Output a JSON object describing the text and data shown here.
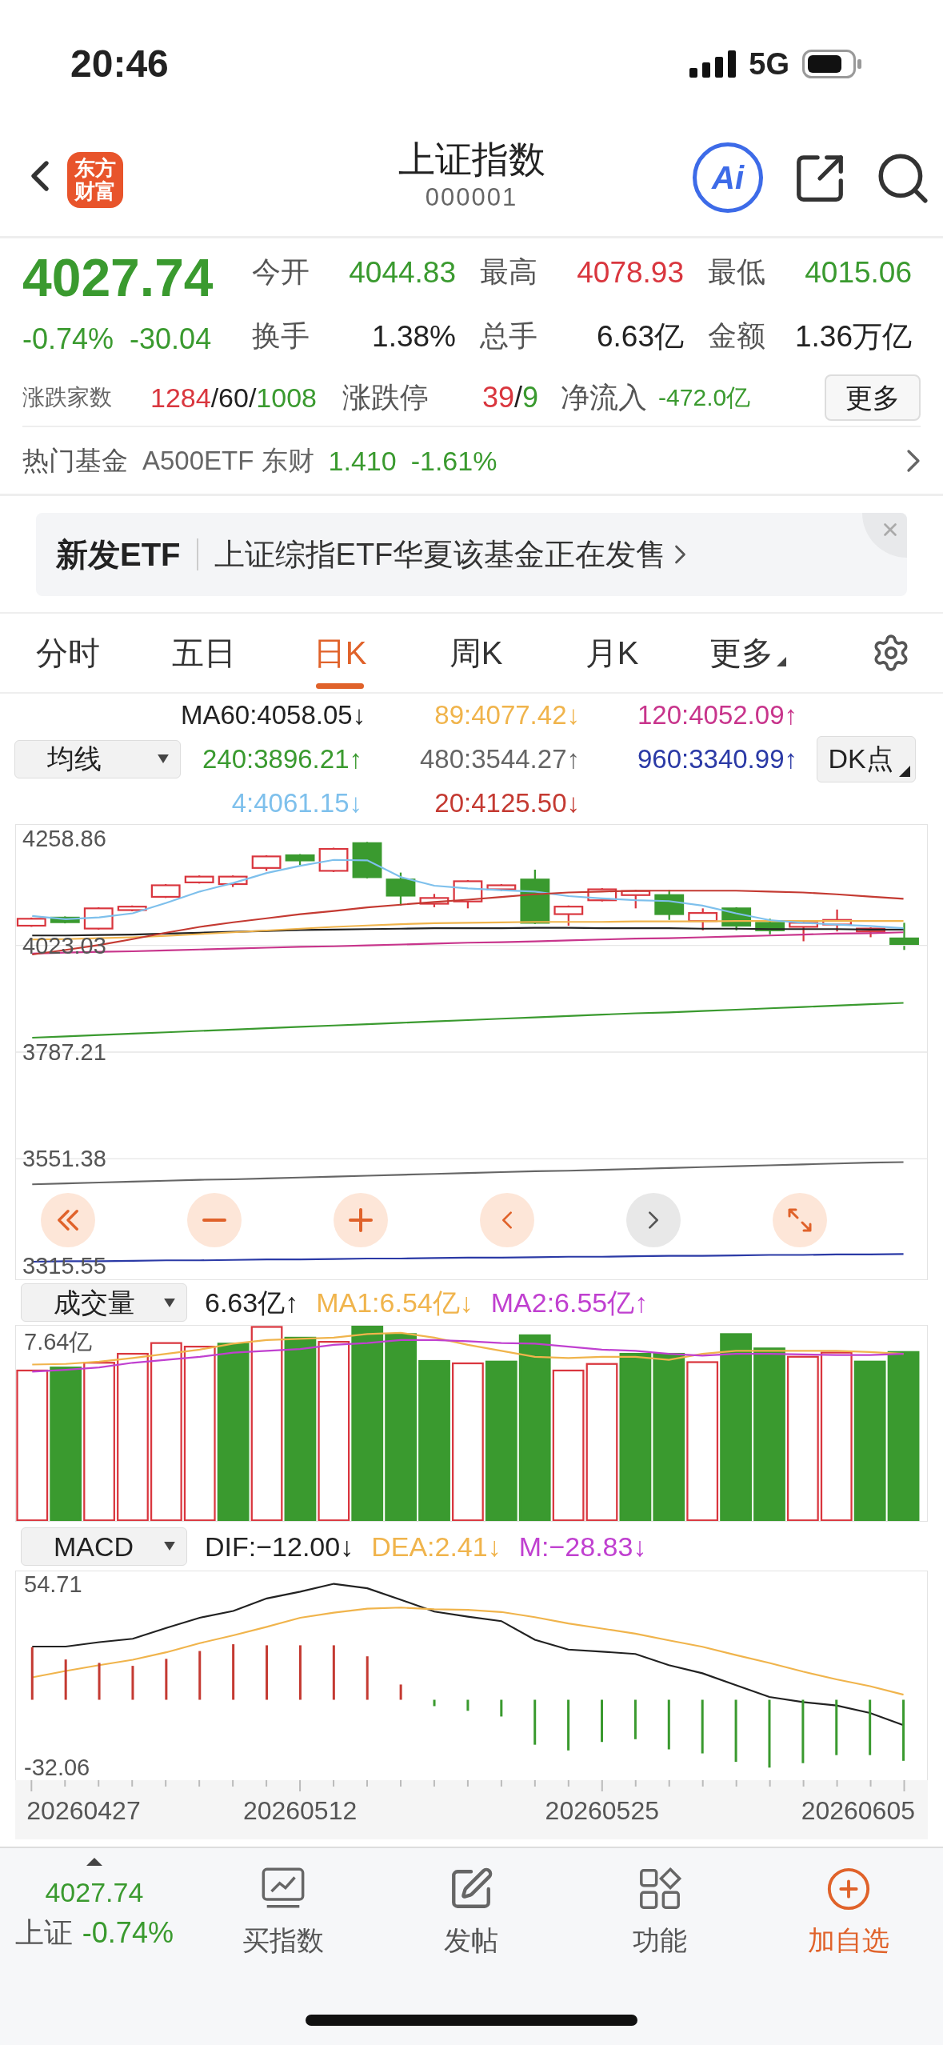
{
  "status_bar": {
    "time": "20:46",
    "network": "5G"
  },
  "header": {
    "logo_text": "东方财富",
    "title": "上证指数",
    "code": "000001",
    "ai_label": "Ai"
  },
  "quote": {
    "price": "4027.74",
    "color": "#3a9a2f",
    "change_pct": "-0.74%",
    "change": "-30.04",
    "stats": [
      {
        "label": "今开",
        "value": "4044.83",
        "color": "#3a9a2f"
      },
      {
        "label": "最高",
        "value": "4078.93",
        "color": "#d9363e"
      },
      {
        "label": "最低",
        "value": "4015.06",
        "color": "#3a9a2f"
      },
      {
        "label": "换手",
        "value": "1.38%",
        "color": "#222222"
      },
      {
        "label": "总手",
        "value": "6.63亿",
        "color": "#222222"
      },
      {
        "label": "金额",
        "value": "1.36万亿",
        "color": "#222222"
      }
    ],
    "breadth": {
      "label": "涨跌家数",
      "parts": [
        {
          "text": "1284",
          "color": "#d9363e"
        },
        {
          "text": "/60/",
          "color": "#222222"
        },
        {
          "text": "1008",
          "color": "#3a9a2f"
        }
      ]
    },
    "limit": {
      "label": "涨跌停",
      "parts": [
        {
          "text": "39",
          "color": "#d9363e"
        },
        {
          "text": "/",
          "color": "#222222"
        },
        {
          "text": "9",
          "color": "#3a9a2f"
        }
      ]
    },
    "net_inflow": {
      "label": "净流入",
      "value": "-472.0亿",
      "color": "#3a9a2f"
    },
    "more_button": "更多"
  },
  "hot_fund": {
    "label": "热门基金",
    "name": "A500ETF 东财",
    "price": "1.410",
    "change": "-1.61%",
    "color": "#3a9a2f"
  },
  "banner": {
    "tag": "新发ETF",
    "text": "上证综指ETF华夏该基金正在发售"
  },
  "tabs": [
    {
      "label": "分时",
      "selected": false,
      "menu": false
    },
    {
      "label": "五日",
      "selected": false,
      "menu": false
    },
    {
      "label": "日K",
      "selected": true,
      "menu": false
    },
    {
      "label": "周K",
      "selected": false,
      "menu": false
    },
    {
      "label": "月K",
      "selected": false,
      "menu": false
    },
    {
      "label": "更多",
      "selected": false,
      "menu": true
    }
  ],
  "ma_legend": {
    "selector": "均线",
    "dk_button": "DK点",
    "items": [
      {
        "text": "MA60:4058.05↓",
        "color": "#222222"
      },
      {
        "text": "89:4077.42↓",
        "color": "#f0b44c"
      },
      {
        "text": "120:4052.09↑",
        "color": "#c8358c"
      },
      {
        "text": "240:3896.21↑",
        "color": "#3a9a2f"
      },
      {
        "text": "480:3544.27↑",
        "color": "#666666"
      },
      {
        "text": "960:3340.99↑",
        "color": "#2b3aa6"
      },
      {
        "text": "4:4061.15↓",
        "color": "#7ec0ec"
      },
      {
        "text": "20:4125.50↓",
        "color": "#c43a32"
      }
    ]
  },
  "price_chart": {
    "chart_data": {
      "type": "line",
      "ylim": [
        3285.04,
        4289.37
      ],
      "grid": true,
      "yticks": [
        {
          "value": 4258.86,
          "label": "4258.86"
        },
        {
          "value": 4023.03,
          "label": "4023.03"
        },
        {
          "value": 3787.21,
          "label": "3787.21"
        },
        {
          "value": 3551.38,
          "label": "3551.38"
        },
        {
          "value": 3315.55,
          "label": "3315.55"
        }
      ],
      "series": [
        {
          "color": "#222222",
          "values": [
            4045,
            4045,
            4046,
            4047,
            4049,
            4051,
            4053,
            4055,
            4057,
            4058,
            4059,
            4060,
            4061,
            4061,
            4061,
            4062,
            4062,
            4061,
            4061,
            4061,
            4060,
            4060,
            4059,
            4059,
            4059,
            4058,
            4058
          ]
        },
        {
          "color": "#f0b44c",
          "values": [
            4036,
            4037,
            4039,
            4041,
            4044,
            4048,
            4052,
            4056,
            4060,
            4064,
            4067,
            4070,
            4072,
            4073,
            4074,
            4075,
            4075,
            4075,
            4076,
            4076,
            4076,
            4077,
            4077,
            4077,
            4077,
            4077,
            4077
          ]
        },
        {
          "color": "#c8358c",
          "values": [
            4005,
            4007,
            4009,
            4010,
            4012,
            4014,
            4016,
            4018,
            4020,
            4021,
            4023,
            4025,
            4027,
            4029,
            4030,
            4032,
            4034,
            4036,
            4038,
            4039,
            4041,
            4043,
            4045,
            4047,
            4049,
            4050,
            4052
          ]
        },
        {
          "color": "#3a9a2f",
          "values": [
            3819,
            3822,
            3825,
            3828,
            3831,
            3834,
            3837,
            3840,
            3843,
            3846,
            3849,
            3852,
            3855,
            3858,
            3861,
            3864,
            3867,
            3870,
            3873,
            3875,
            3878,
            3881,
            3884,
            3887,
            3890,
            3893,
            3896
          ]
        },
        {
          "color": "#666666",
          "values": [
            3495,
            3497,
            3499,
            3501,
            3503,
            3505,
            3506,
            3508,
            3510,
            3512,
            3514,
            3516,
            3518,
            3520,
            3522,
            3524,
            3525,
            3527,
            3529,
            3531,
            3533,
            3535,
            3537,
            3539,
            3541,
            3543,
            3544
          ]
        },
        {
          "color": "#2b3aa6",
          "values": [
            3324,
            3325,
            3325,
            3326,
            3327,
            3327,
            3328,
            3329,
            3329,
            3330,
            3331,
            3331,
            3332,
            3333,
            3333,
            3334,
            3335,
            3335,
            3336,
            3337,
            3337,
            3338,
            3339,
            3339,
            3340,
            3340,
            3341
          ]
        },
        {
          "color": "#7ec0ec",
          "values": [
            4088,
            4081,
            4085,
            4094,
            4117,
            4142,
            4161,
            4183,
            4199,
            4212,
            4211,
            4174,
            4155,
            4149,
            4145,
            4142,
            4132,
            4127,
            4123,
            4121,
            4111,
            4094,
            4079,
            4073,
            4069,
            4066,
            4061
          ]
        },
        {
          "color": "#c43a32",
          "values": [
            4003,
            4013,
            4024,
            4037,
            4051,
            4064,
            4074,
            4083,
            4092,
            4099,
            4107,
            4113,
            4119,
            4124,
            4130,
            4136,
            4140,
            4142,
            4144,
            4144,
            4144,
            4144,
            4142,
            4140,
            4136,
            4131,
            4126
          ]
        }
      ]
    }
  },
  "chart_nav": [
    {
      "disabled": false
    },
    {
      "disabled": false
    },
    {
      "disabled": false
    },
    {
      "disabled": false
    },
    {
      "disabled": true
    },
    {
      "disabled": false
    }
  ],
  "volume": {
    "selector": "成交量",
    "axis_label": "7.64亿",
    "readings": [
      {
        "text": "6.63亿↑",
        "color": "#222222"
      },
      {
        "text": "MA1:6.54亿↓",
        "color": "#f0b44c"
      },
      {
        "text": "MA2:6.55亿↑",
        "color": "#c040d0"
      }
    ]
  },
  "macd": {
    "selector": "MACD",
    "readings": [
      {
        "text": "DIF:−12.00↓",
        "color": "#222222"
      },
      {
        "text": "DEA:2.41↓",
        "color": "#f0b44c"
      },
      {
        "text": "M:−28.83↓",
        "color": "#c040d0"
      }
    ],
    "chart_data": {
      "type": "line",
      "ylim": [
        -37.93,
        60.58
      ],
      "yticks": [
        {
          "value": 54.71,
          "label": "54.71"
        },
        {
          "value": -32.06,
          "label": "-32.06"
        }
      ],
      "series": [
        {
          "color": "#222222",
          "type": "line",
          "values": [
            25.1,
            25.1,
            27.2,
            28.8,
            33.9,
            38.7,
            41.9,
            47.8,
            51,
            54.7,
            52.6,
            47.2,
            41.6,
            39.2,
            37.1,
            28.3,
            23.7,
            22.7,
            21.6,
            16.3,
            12.5,
            6.9,
            1.3,
            -1.1,
            -2.7,
            -6.2,
            -12
          ]
        },
        {
          "color": "#f0b44c",
          "type": "line",
          "values": [
            10.6,
            13.6,
            16.3,
            18.9,
            22.4,
            26.7,
            30.4,
            34.4,
            38.7,
            41.1,
            43,
            43.5,
            42.7,
            42.4,
            41.4,
            39,
            36,
            33.6,
            31.2,
            28,
            25,
            21.1,
            17.4,
            13.3,
            9.6,
            6.4,
            2.4
          ]
        },
        {
          "color": "#c43a32",
          "type": "bar",
          "values": [
            24.8,
            19,
            17.4,
            16,
            19.3,
            23,
            26.2,
            25.7,
            25.7,
            25.7,
            20.5,
            7.2,
            null,
            null,
            null,
            null,
            null,
            null,
            null,
            null,
            null,
            null,
            null,
            null,
            null,
            null,
            null
          ]
        },
        {
          "color": "#3a9a2f",
          "type": "bar",
          "values": [
            null,
            null,
            null,
            null,
            null,
            null,
            null,
            null,
            null,
            null,
            null,
            null,
            -3,
            -5.2,
            -7.9,
            -21.2,
            -23.9,
            -19.9,
            -18.6,
            -23.4,
            -25.3,
            -29.3,
            -32,
            -29.9,
            -26.1,
            -26.1,
            -28.8
          ]
        }
      ]
    },
    "date_labels": [
      "20260427",
      "20260512",
      "20260525",
      "20260605"
    ]
  },
  "bottom_bar": {
    "index_price": "4027.74",
    "index_name": "上证",
    "index_change": "-0.74%",
    "color": "#3a9a2f",
    "items": [
      {
        "label": "买指数",
        "accent": false
      },
      {
        "label": "发帖",
        "accent": false
      },
      {
        "label": "功能",
        "accent": false
      },
      {
        "label": "加自选",
        "accent": true
      }
    ]
  }
}
